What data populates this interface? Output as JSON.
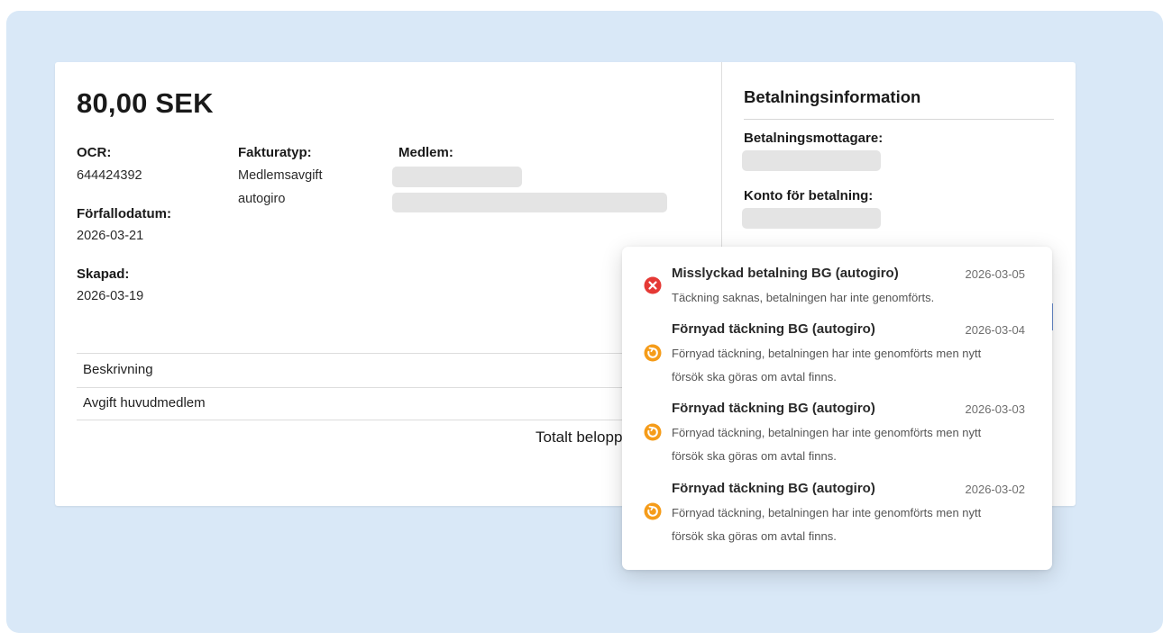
{
  "invoice": {
    "amount": "80,00 SEK",
    "ocr_label": "OCR:",
    "ocr_value": "644424392",
    "due_label": "Förfallodatum:",
    "due_value": "2026-03-21",
    "created_label": "Skapad:",
    "created_value": "2026-03-19",
    "type_label": "Fakturatyp:",
    "type_values": [
      "Medlemsavgift",
      "autogiro"
    ],
    "member_label": "Medlem:"
  },
  "table": {
    "header": "Beskrivning",
    "rows": [
      "Avgift huvudmedlem"
    ],
    "total_label": "Totalt belopp"
  },
  "payment_info": {
    "title": "Betalningsinformation",
    "recipient_label": "Betalningsmottagare:",
    "account_label": "Konto för betalning:"
  },
  "events": [
    {
      "title": "Misslyckad betalning BG (autogiro)",
      "date": "2026-03-05",
      "description": "Täckning saknas, betalningen har inte genomförts.",
      "icon": "error-icon",
      "color": "#e53935"
    },
    {
      "title": "Förnyad täckning BG (autogiro)",
      "date": "2026-03-04",
      "description": "Förnyad täckning, betalningen har inte genomförts men nytt försök ska göras om avtal finns.",
      "icon": "retry-icon",
      "color": "#f59c1a"
    },
    {
      "title": "Förnyad täckning BG (autogiro)",
      "date": "2026-03-03",
      "description": "Förnyad täckning, betalningen har inte genomförts men nytt försök ska göras om avtal finns.",
      "icon": "retry-icon",
      "color": "#f59c1a"
    },
    {
      "title": "Förnyad täckning BG (autogiro)",
      "date": "2026-03-02",
      "description": "Förnyad täckning, betalningen har inte genomförts men nytt försök ska göras om avtal finns.",
      "icon": "retry-icon",
      "color": "#f59c1a"
    }
  ],
  "colors": {
    "background": "#d9e8f7",
    "error": "#e53935",
    "warning": "#f59c1a"
  }
}
